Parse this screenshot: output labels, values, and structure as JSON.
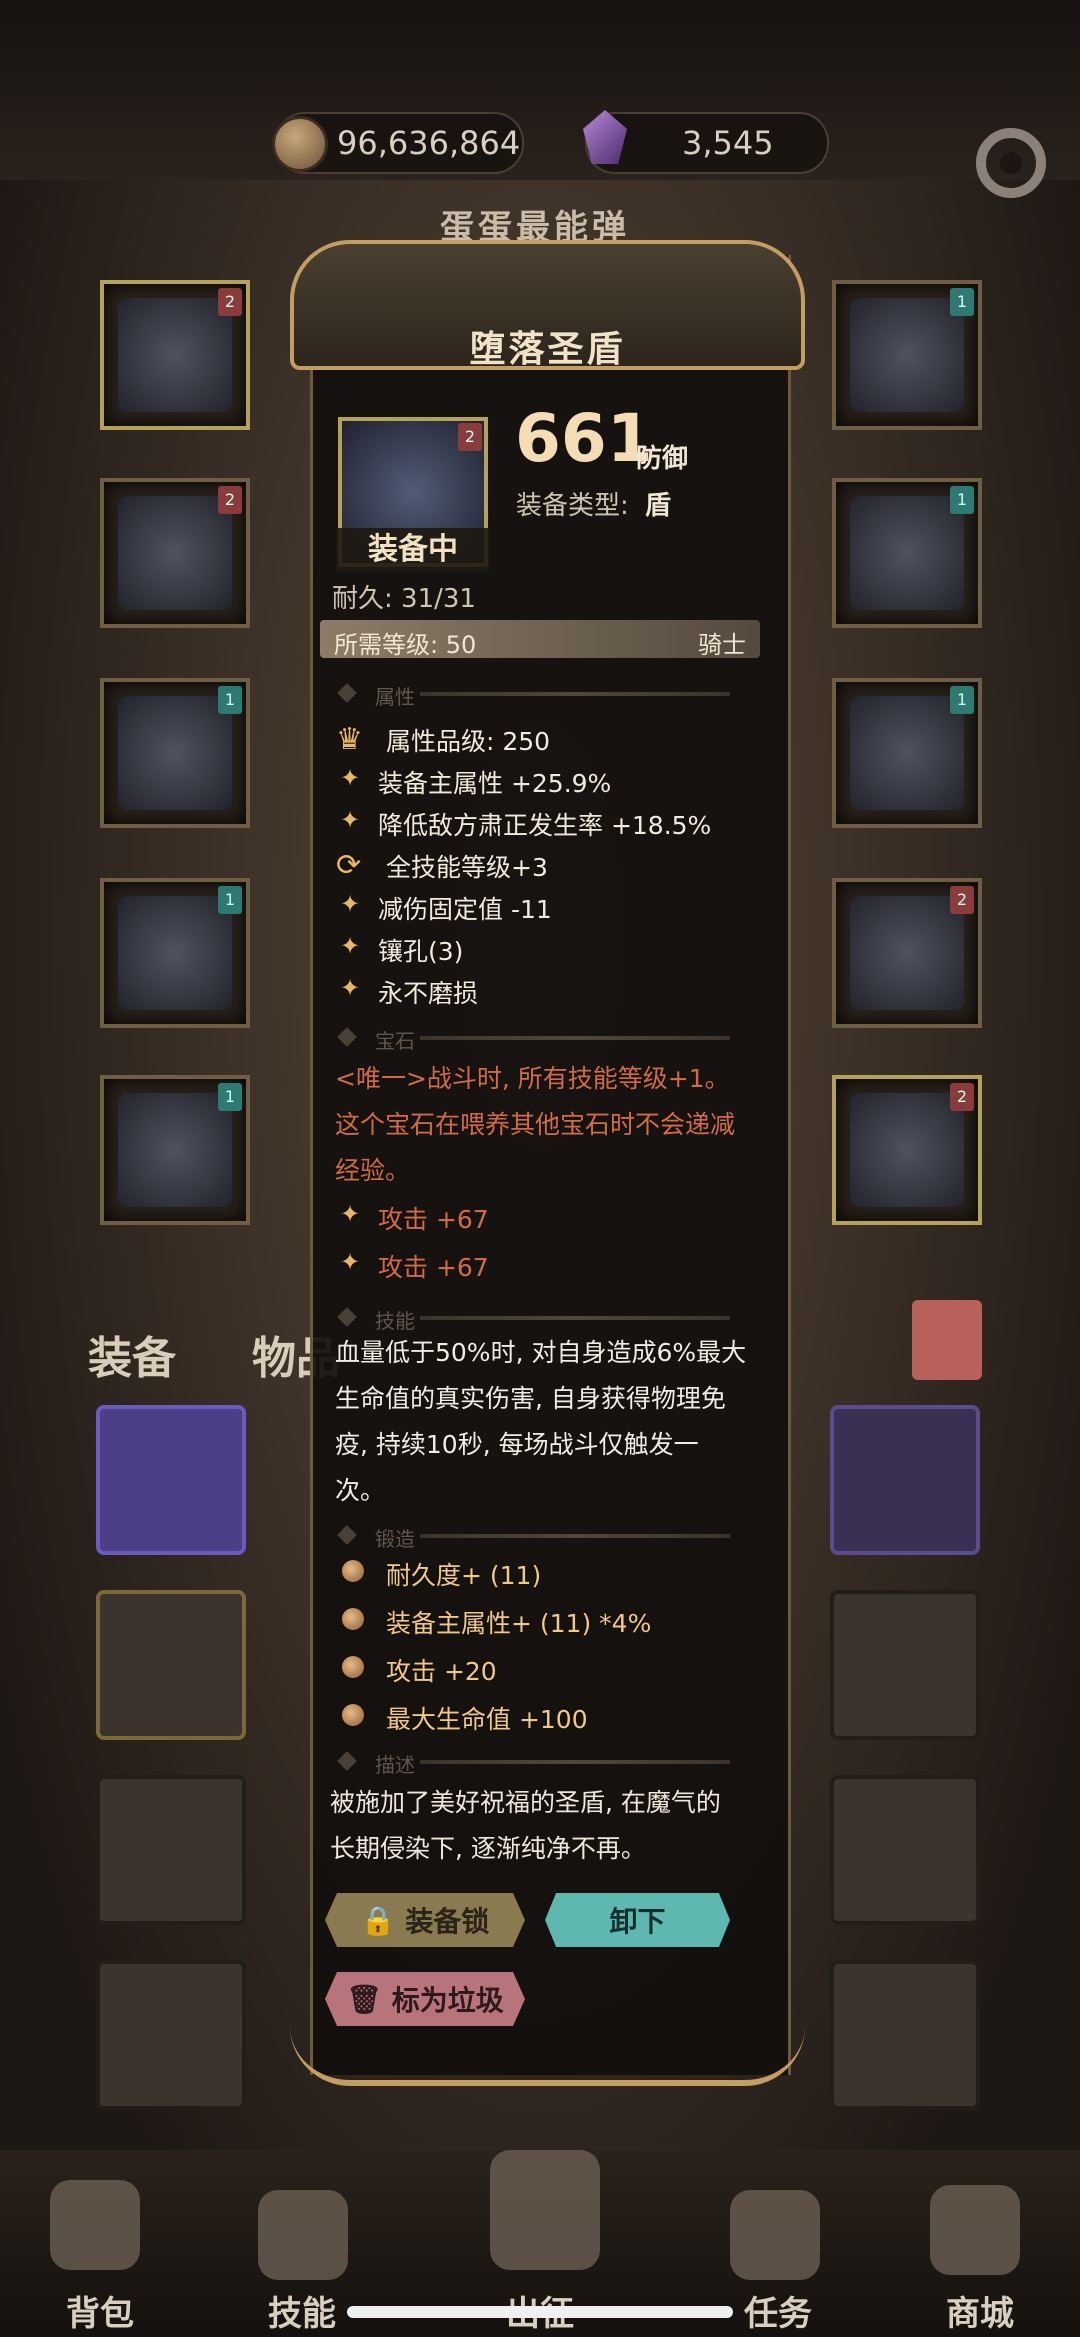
{
  "currencies": {
    "gold": "96,636,864",
    "gems": "3,545"
  },
  "player_name": "蛋蛋最能弹",
  "inventory_tabs": {
    "equipment": "装备",
    "items": "物品"
  },
  "item": {
    "title": "堕落圣盾",
    "value": "661",
    "value_unit": "防御",
    "type_label": "装备类型:",
    "type_value": "盾",
    "equipped_label": "装备中",
    "durability": "耐久: 31/31",
    "required_level": "所需等级: 50",
    "class": "骑士",
    "badge": "2"
  },
  "sections": {
    "attributes": "属性",
    "gem": "宝石",
    "skill": "技能",
    "forge": "锻造",
    "description": "描述"
  },
  "attributes": [
    "属性品级: 250",
    "装备主属性 +25.9%",
    "降低敌方肃正发生率 +18.5%",
    "全技能等级+3",
    "减伤固定值 -11",
    "镶孔(3)",
    "永不磨损"
  ],
  "gem": {
    "lines": [
      "<唯一>战斗时, 所有技能等级+1。",
      "这个宝石在喂养其他宝石时不会递减",
      "经验。"
    ],
    "stats": [
      "攻击 +67",
      "攻击 +67"
    ]
  },
  "skill_lines": [
    "血量低于50%时, 对自身造成6%最大",
    "生命值的真实伤害, 自身获得物理免",
    "疫, 持续10秒, 每场战斗仅触发一",
    "次。"
  ],
  "forge": [
    "耐久度+ (11)",
    "装备主属性+ (11) *4%",
    "攻击 +20",
    "最大生命值 +100"
  ],
  "description_lines": [
    "被施加了美好祝福的圣盾, 在魔气的",
    "长期侵染下, 逐渐纯净不再。"
  ],
  "buttons": {
    "lock": "装备锁",
    "unequip": "卸下",
    "trash": "标为垃圾"
  },
  "nav": [
    "背包",
    "技能",
    "出征",
    "任务",
    "商城"
  ],
  "colors": {
    "gem_text": "#d06b48",
    "forge_text": "#f0c88a",
    "accent": "#c49d62",
    "unequip": "#5fb8b0"
  }
}
